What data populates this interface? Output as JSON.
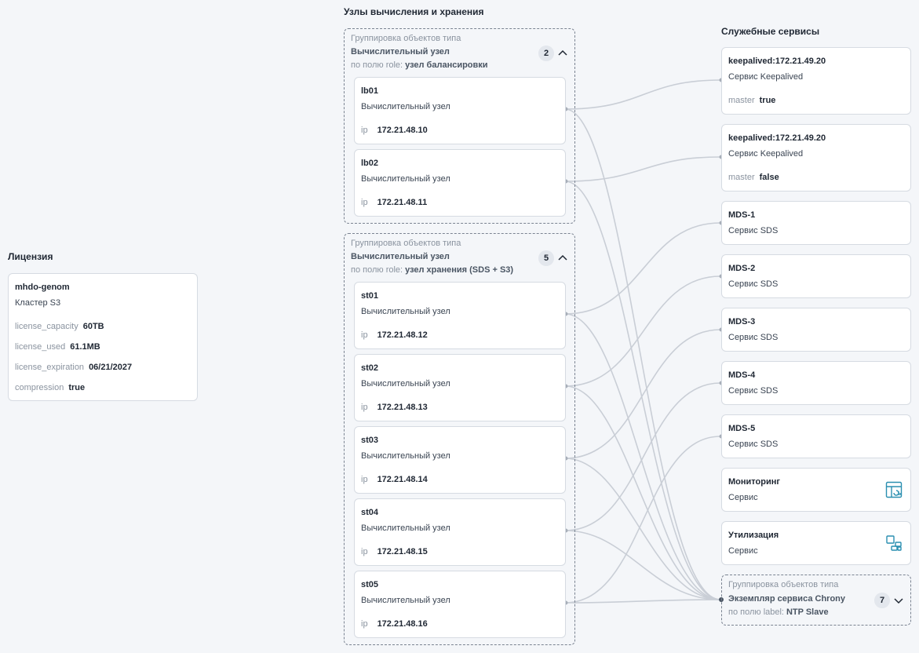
{
  "sections": {
    "license": "Лицензия",
    "nodes": "Узлы вычисления и хранения",
    "services": "Служебные сервисы"
  },
  "license_card": {
    "name": "mhdo-genom",
    "subtitle": "Кластер S3",
    "props": [
      {
        "key": "license_capacity",
        "value": "60TB"
      },
      {
        "key": "license_used",
        "value": "61.1MB"
      },
      {
        "key": "license_expiration",
        "value": "06/21/2027"
      },
      {
        "key": "compression",
        "value": "true"
      }
    ]
  },
  "groups": [
    {
      "caption": "Группировка объектов типа",
      "type": "Вычислительный узел",
      "field_label": "по полю role:",
      "field_value": "узел балансировки",
      "count": "2",
      "nodes": [
        {
          "name": "lb01",
          "subtitle": "Вычислительный узел",
          "ip_label": "ip",
          "ip": "172.21.48.10"
        },
        {
          "name": "lb02",
          "subtitle": "Вычислительный узел",
          "ip_label": "ip",
          "ip": "172.21.48.11"
        }
      ]
    },
    {
      "caption": "Группировка объектов типа",
      "type": "Вычислительный узел",
      "field_label": "по полю role:",
      "field_value": "узел хранения (SDS + S3)",
      "count": "5",
      "nodes": [
        {
          "name": "st01",
          "subtitle": "Вычислительный узел",
          "ip_label": "ip",
          "ip": "172.21.48.12"
        },
        {
          "name": "st02",
          "subtitle": "Вычислительный узел",
          "ip_label": "ip",
          "ip": "172.21.48.13"
        },
        {
          "name": "st03",
          "subtitle": "Вычислительный узел",
          "ip_label": "ip",
          "ip": "172.21.48.14"
        },
        {
          "name": "st04",
          "subtitle": "Вычислительный узел",
          "ip_label": "ip",
          "ip": "172.21.48.15"
        },
        {
          "name": "st05",
          "subtitle": "Вычислительный узел",
          "ip_label": "ip",
          "ip": "172.21.48.16"
        }
      ]
    }
  ],
  "services": [
    {
      "name": "keepalived:172.21.49.20",
      "subtitle": "Сервис Keepalived",
      "prop_key": "master",
      "prop_value": "true"
    },
    {
      "name": "keepalived:172.21.49.20",
      "subtitle": "Сервис Keepalived",
      "prop_key": "master",
      "prop_value": "false"
    },
    {
      "name": "MDS-1",
      "subtitle": "Сервис SDS"
    },
    {
      "name": "MDS-2",
      "subtitle": "Сервис SDS"
    },
    {
      "name": "MDS-3",
      "subtitle": "Сервис SDS"
    },
    {
      "name": "MDS-4",
      "subtitle": "Сервис SDS"
    },
    {
      "name": "MDS-5",
      "subtitle": "Сервис SDS"
    },
    {
      "name": "Мониторинг",
      "subtitle": "Сервис",
      "icon": "monitoring-dashboard-icon"
    },
    {
      "name": "Утилизация",
      "subtitle": "Сервис",
      "icon": "utilization-blocks-icon"
    }
  ],
  "chrony_group": {
    "caption": "Группировка объектов типа",
    "type": "Экземпляр сервиса Chrony",
    "field_label": "по полю label:",
    "field_value": "NTP Slave",
    "count": "7"
  },
  "colors": {
    "link": "#c9ced6",
    "icon_accent": "#2a8fb0",
    "dashed_border": "#7a8391"
  }
}
